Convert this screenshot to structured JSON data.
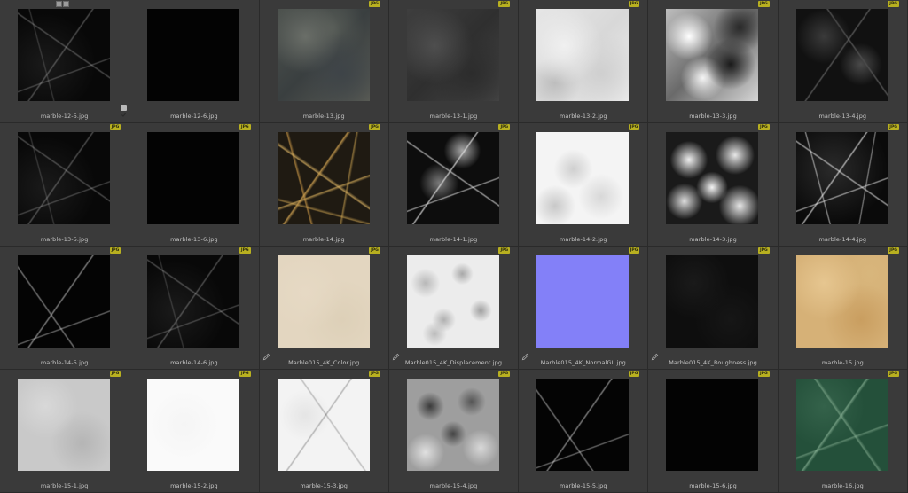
{
  "badge_label": "JPG",
  "colors": {
    "background": "#2b2b2b",
    "cell": "#3a3a3a",
    "badge": "#b8b020",
    "filename": "#c4c4c4"
  },
  "top_icons": [
    "grid-icon",
    "pencil-icon"
  ],
  "items": [
    {
      "filename": "marble-12-5.jpg",
      "texture": "t-black-veins",
      "badge": false,
      "checked": true,
      "edited": false
    },
    {
      "filename": "marble-12-6.jpg",
      "texture": "t-verydark",
      "badge": false,
      "checked": false,
      "edited": false
    },
    {
      "filename": "marble-13.jpg",
      "texture": "t-grayblue",
      "badge": true,
      "checked": false,
      "edited": false
    },
    {
      "filename": "marble-13-1.jpg",
      "texture": "t-darkgray",
      "badge": true,
      "checked": false,
      "edited": false
    },
    {
      "filename": "marble-13-2.jpg",
      "texture": "t-lightgray",
      "badge": true,
      "checked": false,
      "edited": false
    },
    {
      "filename": "marble-13-3.jpg",
      "texture": "t-highcontrast",
      "badge": true,
      "checked": false,
      "edited": false
    },
    {
      "filename": "marble-13-4.jpg",
      "texture": "t-darkmottled",
      "badge": true,
      "checked": false,
      "edited": false
    },
    {
      "filename": "marble-13-5.jpg",
      "texture": "t-black-veins",
      "badge": true,
      "checked": false,
      "edited": false
    },
    {
      "filename": "marble-13-6.jpg",
      "texture": "t-verydark",
      "badge": true,
      "checked": false,
      "edited": false
    },
    {
      "filename": "marble-14.jpg",
      "texture": "t-goldveins",
      "badge": true,
      "checked": false,
      "edited": false
    },
    {
      "filename": "marble-14-1.jpg",
      "texture": "t-whiteveins-dense",
      "badge": true,
      "checked": false,
      "edited": false
    },
    {
      "filename": "marble-14-2.jpg",
      "texture": "t-whitegrain",
      "badge": true,
      "checked": false,
      "edited": false
    },
    {
      "filename": "marble-14-3.jpg",
      "texture": "t-busybw",
      "badge": true,
      "checked": false,
      "edited": false
    },
    {
      "filename": "marble-14-4.jpg",
      "texture": "t-black-veins-bright",
      "badge": true,
      "checked": false,
      "edited": false
    },
    {
      "filename": "marble-14-5.jpg",
      "texture": "t-sparsewhite",
      "badge": true,
      "checked": false,
      "edited": false
    },
    {
      "filename": "marble-14-6.jpg",
      "texture": "t-black-veins",
      "badge": true,
      "checked": false,
      "edited": false
    },
    {
      "filename": "Marble015_4K_Color.jpg",
      "texture": "t-cream",
      "badge": true,
      "checked": false,
      "edited": true
    },
    {
      "filename": "Marble015_4K_Displacement.jpg",
      "texture": "t-displacement",
      "badge": true,
      "checked": false,
      "edited": true
    },
    {
      "filename": "Marble015_4K_NormalGL.jpg",
      "texture": "t-normal",
      "badge": true,
      "checked": false,
      "edited": true
    },
    {
      "filename": "Marble015_4K_Roughness.jpg",
      "texture": "t-rough",
      "badge": true,
      "checked": false,
      "edited": true
    },
    {
      "filename": "marble-15.jpg",
      "texture": "t-tan",
      "badge": true,
      "checked": false,
      "edited": false
    },
    {
      "filename": "marble-15-1.jpg",
      "texture": "t-lightgray-speckle",
      "badge": true,
      "checked": false,
      "edited": false
    },
    {
      "filename": "marble-15-2.jpg",
      "texture": "t-white",
      "badge": true,
      "checked": false,
      "edited": false
    },
    {
      "filename": "marble-15-3.jpg",
      "texture": "t-whiteveins-light",
      "badge": true,
      "checked": false,
      "edited": false
    },
    {
      "filename": "marble-15-4.jpg",
      "texture": "t-grayspeckle",
      "badge": true,
      "checked": false,
      "edited": false
    },
    {
      "filename": "marble-15-5.jpg",
      "texture": "t-sparsewhite",
      "badge": true,
      "checked": false,
      "edited": false
    },
    {
      "filename": "marble-15-6.jpg",
      "texture": "t-verydark",
      "badge": true,
      "checked": false,
      "edited": false
    },
    {
      "filename": "marble-16.jpg",
      "texture": "t-green",
      "badge": true,
      "checked": false,
      "edited": false
    }
  ]
}
